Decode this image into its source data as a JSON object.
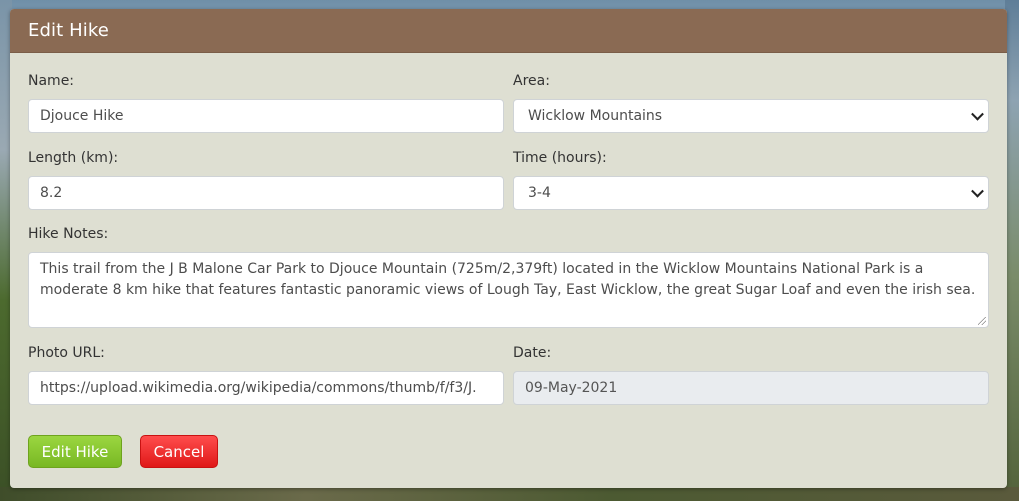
{
  "modal": {
    "title": "Edit Hike"
  },
  "form": {
    "name": {
      "label": "Name:",
      "value": "Djouce Hike"
    },
    "area": {
      "label": "Area:",
      "value": "Wicklow Mountains"
    },
    "length": {
      "label": "Length (km):",
      "value": "8.2"
    },
    "time": {
      "label": "Time (hours):",
      "value": "3-4"
    },
    "notes": {
      "label": "Hike Notes:",
      "value": "This trail from the J B Malone Car Park to Djouce Mountain (725m/2,379ft) located in the Wicklow Mountains National Park is a moderate 8 km  hike that features fantastic panoramic views of Lough Tay, East Wicklow, the great Sugar Loaf and even the irish sea."
    },
    "photo_url": {
      "label": "Photo URL:",
      "value": "https://upload.wikimedia.org/wikipedia/commons/thumb/f/f3/J."
    },
    "date": {
      "label": "Date:",
      "value": "09-May-2021"
    }
  },
  "buttons": {
    "submit_label": "Edit Hike",
    "cancel_label": "Cancel"
  },
  "colors": {
    "header": "#8a6a53",
    "modal_body": "#dedfd2",
    "submit": "#85c42b",
    "cancel": "#f22a2a"
  },
  "icons": {
    "select_arrow": "chevron-down-icon",
    "textarea_resize": "resize-grip-icon"
  }
}
